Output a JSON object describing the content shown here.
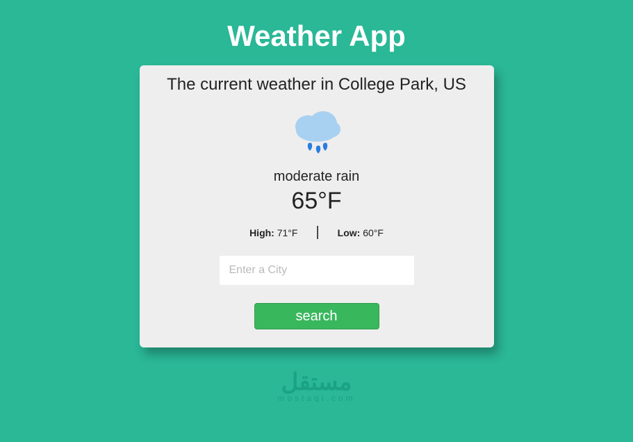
{
  "app": {
    "title": "Weather App"
  },
  "card": {
    "subtitle": "The current weather in College Park, US",
    "icon": "rain-cloud-icon",
    "condition": "moderate rain",
    "temp": "65°F",
    "high_label": "High:",
    "high_value": "71°F",
    "low_label": "Low:",
    "low_value": "60°F",
    "separator": "|",
    "input_placeholder": "Enter a City",
    "input_value": "",
    "search_label": "search"
  },
  "footer": {
    "brand_ar": "مستقل",
    "brand_en": "mostaql.com"
  },
  "colors": {
    "background": "#2ab897",
    "card": "#eeeeee",
    "button": "#39b75d"
  }
}
